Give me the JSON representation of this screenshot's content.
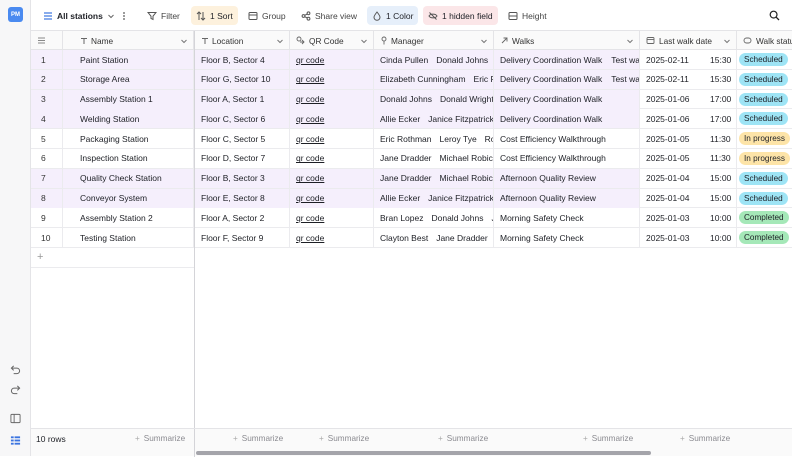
{
  "app": {
    "logo_text": "PM"
  },
  "toolbar": {
    "view_name": "All stations",
    "filter_label": "Filter",
    "sort_label": "1 Sort",
    "group_label": "Group",
    "share_label": "Share view",
    "color_label": "1 Color",
    "hidden_label": "1 hidden field",
    "height_label": "Height"
  },
  "columns": {
    "name": "Name",
    "location": "Location",
    "qr": "QR Code",
    "manager": "Manager",
    "walks": "Walks",
    "date": "Last walk date",
    "status": "Walk status"
  },
  "rows": [
    {
      "num": "1",
      "name": "Paint Station",
      "location": "Floor B, Sector 4",
      "qr": "qr code",
      "managers": [
        "Cinda Pullen",
        "Donald Johns",
        "J"
      ],
      "walks": [
        "Delivery Coordination Walk",
        "Test walk"
      ],
      "date": "2025-02-11",
      "time": "15:30",
      "status": "Scheduled",
      "status_kind": "sched",
      "highlight": true
    },
    {
      "num": "2",
      "name": "Storage Area",
      "location": "Floor G, Sector 10",
      "qr": "qr code",
      "managers": [
        "Elizabeth Cunningham",
        "Eric Ro"
      ],
      "walks": [
        "Delivery Coordination Walk",
        "Test walk"
      ],
      "date": "2025-02-11",
      "time": "15:30",
      "status": "Scheduled",
      "status_kind": "sched",
      "highlight": true
    },
    {
      "num": "3",
      "name": "Assembly Station 1",
      "location": "Floor A, Sector 1",
      "qr": "qr code",
      "managers": [
        "Donald Johns",
        "Donald Wright"
      ],
      "walks": [
        "Delivery Coordination Walk"
      ],
      "date": "2025-01-06",
      "time": "17:00",
      "status": "Scheduled",
      "status_kind": "sched",
      "highlight": true
    },
    {
      "num": "4",
      "name": "Welding Station",
      "location": "Floor C, Sector 6",
      "qr": "qr code",
      "managers": [
        "Allie Ecker",
        "Janice Fitzpatrick"
      ],
      "walks": [
        "Delivery Coordination Walk"
      ],
      "date": "2025-01-06",
      "time": "17:00",
      "status": "Scheduled",
      "status_kind": "sched",
      "highlight": true
    },
    {
      "num": "5",
      "name": "Packaging Station",
      "location": "Floor C, Sector 5",
      "qr": "qr code",
      "managers": [
        "Eric Rothman",
        "Leroy Tye",
        "Roc"
      ],
      "walks": [
        "Cost Efficiency Walkthrough"
      ],
      "date": "2025-01-05",
      "time": "11:30",
      "status": "In progress",
      "status_kind": "prog",
      "highlight": false
    },
    {
      "num": "6",
      "name": "Inspection Station",
      "location": "Floor D, Sector 7",
      "qr": "qr code",
      "managers": [
        "Jane Dradder",
        "Michael Robich"
      ],
      "walks": [
        "Cost Efficiency Walkthrough"
      ],
      "date": "2025-01-05",
      "time": "11:30",
      "status": "In progress",
      "status_kind": "prog",
      "highlight": false
    },
    {
      "num": "7",
      "name": "Quality Check Station",
      "location": "Floor B, Sector 3",
      "qr": "qr code",
      "managers": [
        "Jane Dradder",
        "Michael Robich"
      ],
      "walks": [
        "Afternoon Quality Review"
      ],
      "date": "2025-01-04",
      "time": "15:00",
      "status": "Scheduled",
      "status_kind": "sched",
      "highlight": true
    },
    {
      "num": "8",
      "name": "Conveyor System",
      "location": "Floor E, Sector 8",
      "qr": "qr code",
      "managers": [
        "Allie Ecker",
        "Janice Fitzpatrick"
      ],
      "walks": [
        "Afternoon Quality Review"
      ],
      "date": "2025-01-04",
      "time": "15:00",
      "status": "Scheduled",
      "status_kind": "sched",
      "highlight": true
    },
    {
      "num": "9",
      "name": "Assembly Station 2",
      "location": "Floor A, Sector 2",
      "qr": "qr code",
      "managers": [
        "Bran Lopez",
        "Donald Johns",
        "Jo"
      ],
      "walks": [
        "Morning Safety Check"
      ],
      "date": "2025-01-03",
      "time": "10:00",
      "status": "Completed",
      "status_kind": "done",
      "highlight": false
    },
    {
      "num": "10",
      "name": "Testing Station",
      "location": "Floor F, Sector 9",
      "qr": "qr code",
      "managers": [
        "Clayton Best",
        "Jane Dradder",
        "J"
      ],
      "walks": [
        "Morning Safety Check"
      ],
      "date": "2025-01-03",
      "time": "10:00",
      "status": "Completed",
      "status_kind": "done",
      "highlight": false
    }
  ],
  "footer": {
    "row_count": "10 rows",
    "summarize_label": "Summarize"
  },
  "colors": {
    "accent": "#4a8af0",
    "row_highlight": "#f5effc",
    "scheduled": "#9ee4f5",
    "in_progress": "#fde4a8",
    "completed": "#a5e8b8"
  }
}
